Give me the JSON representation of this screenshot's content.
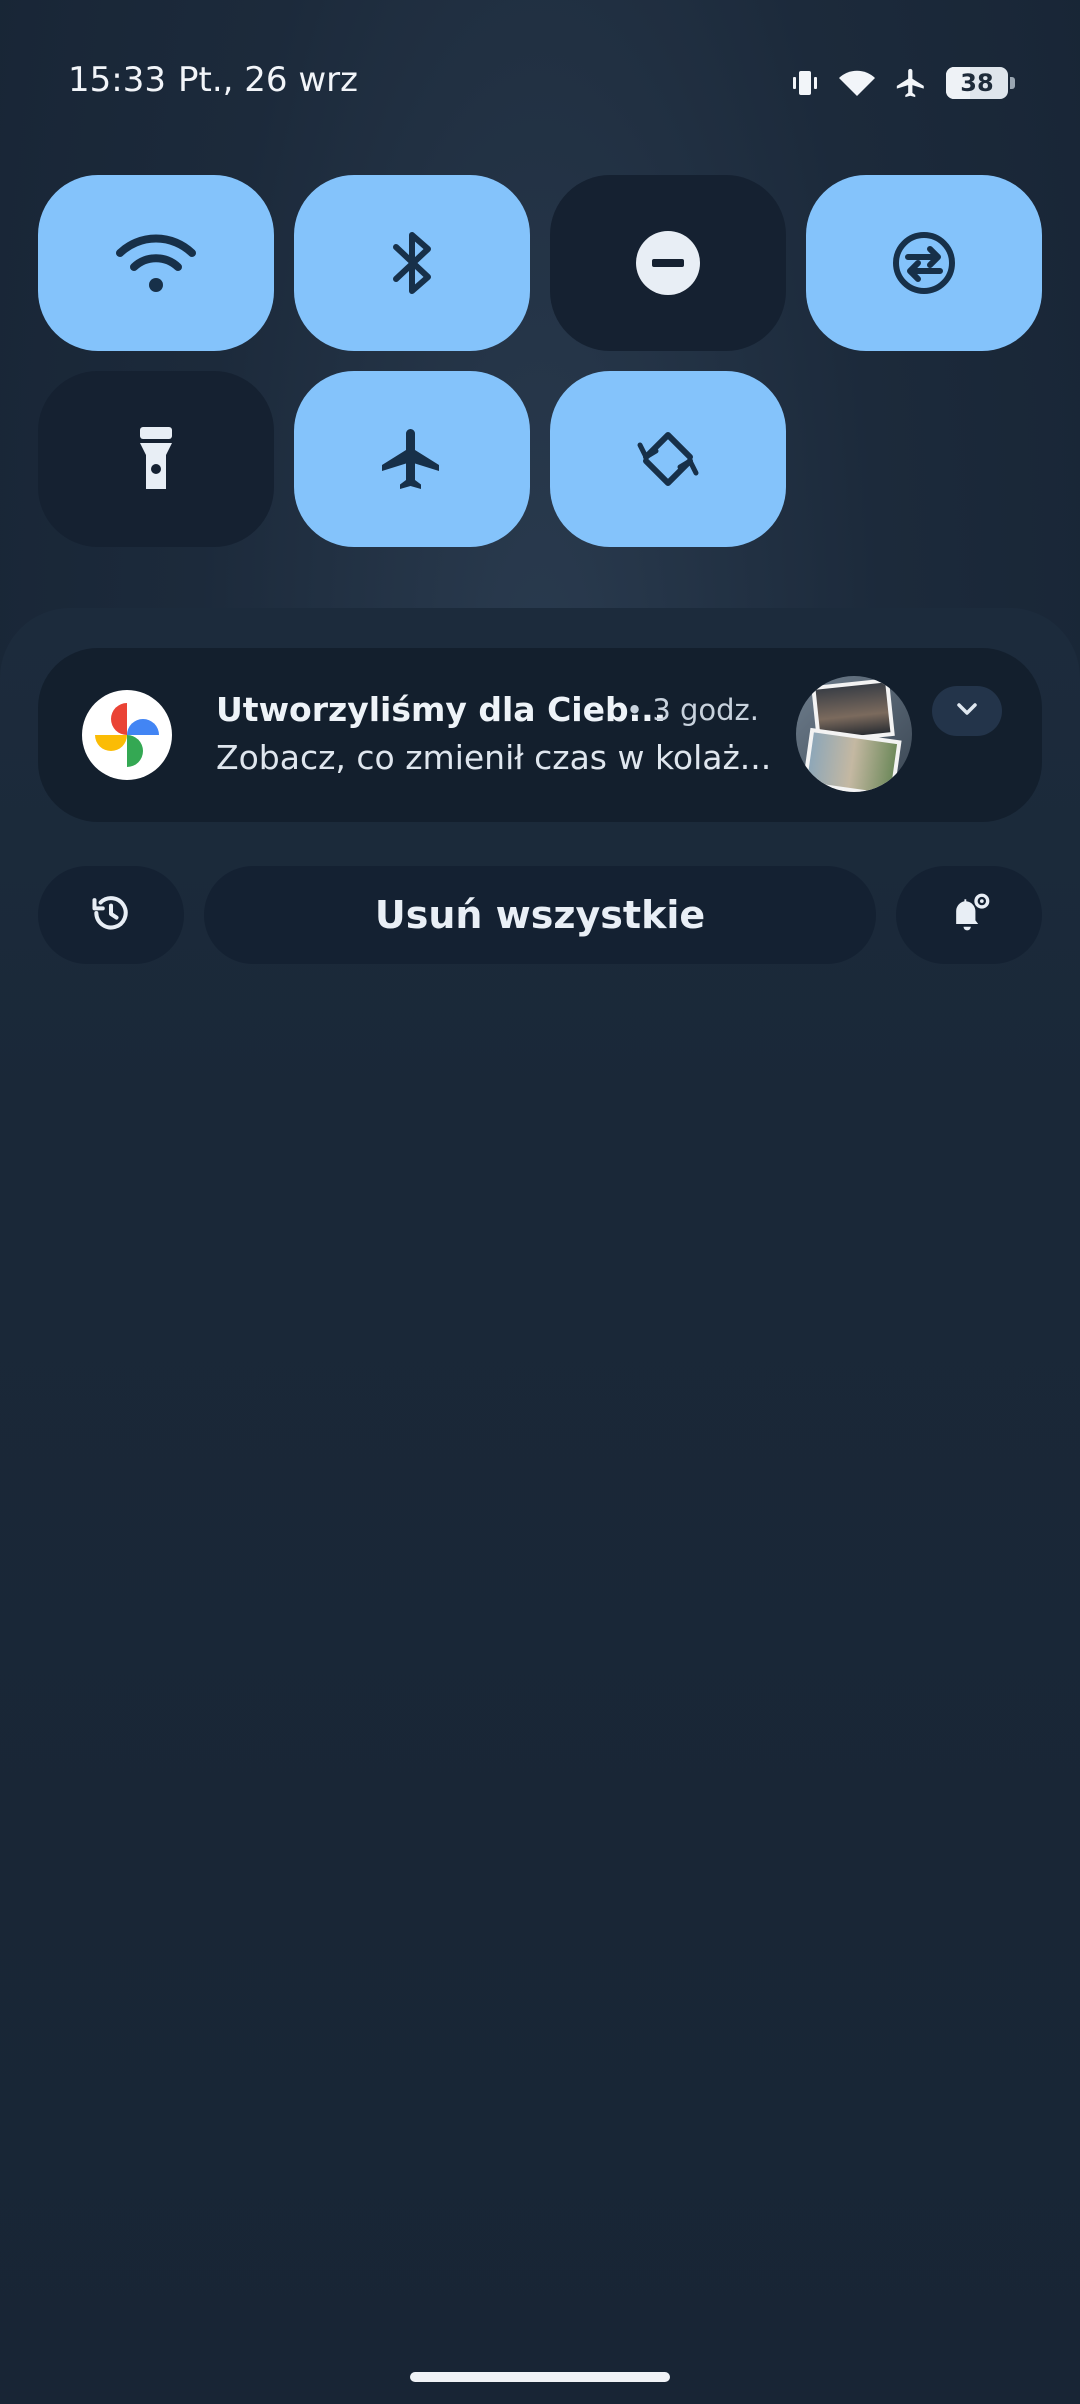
{
  "status_bar": {
    "time": "15:33",
    "date": "Pt., 26 wrz",
    "battery_level": "38",
    "icons": [
      "vibrate-icon",
      "wifi-icon",
      "airplane-icon",
      "battery-icon"
    ]
  },
  "quick_settings": {
    "tiles": [
      {
        "id": "wifi",
        "icon": "wifi-icon",
        "state": "on"
      },
      {
        "id": "bluetooth",
        "icon": "bluetooth-icon",
        "state": "on"
      },
      {
        "id": "do-not-disturb",
        "icon": "do-not-disturb-icon",
        "state": "off"
      },
      {
        "id": "data-saver",
        "icon": "data-saver-icon",
        "state": "on"
      },
      {
        "id": "flashlight",
        "icon": "flashlight-icon",
        "state": "off"
      },
      {
        "id": "airplane-mode",
        "icon": "airplane-icon",
        "state": "on"
      },
      {
        "id": "auto-rotate",
        "icon": "auto-rotate-icon",
        "state": "on"
      }
    ],
    "colors": {
      "on": "#84c3fb",
      "off": "#152131",
      "icon_on": "#173049",
      "icon_off": "#e8eef5"
    }
  },
  "notification": {
    "app_icon": "google-photos-icon",
    "title": "Utworzyliśmy dla Cieb...",
    "time": "• 3 godz.",
    "body": "Zobacz, co zmienił czas w kolaż...",
    "thumbnail": "collage-thumbnail"
  },
  "actions": {
    "history_icon": "history-icon",
    "clear_all_label": "Usuń wszystkie",
    "settings_icon": "notification-settings-icon"
  }
}
